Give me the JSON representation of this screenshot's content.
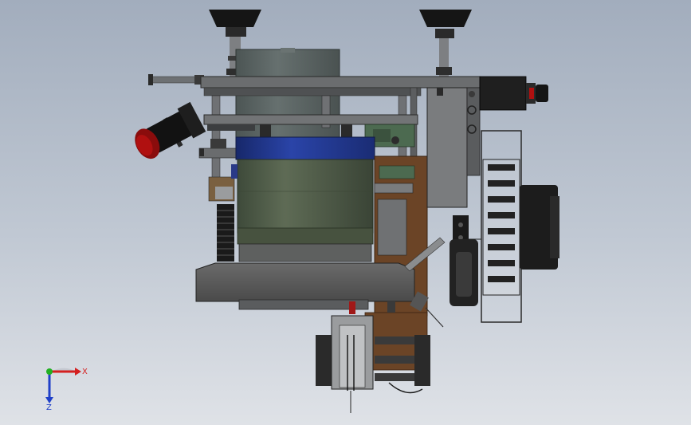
{
  "viewport": {
    "background_top": "#a2adbd",
    "background_bottom": "#dfe2e7"
  },
  "model_colors": {
    "frame": "#4a4c4e",
    "cylinder_blue": "#1f3588",
    "cylinder_green": "#4f5c48",
    "rust_plate": "#6b4426",
    "red_accent": "#b01010"
  },
  "triad": {
    "x_label": "X",
    "z_label": "Z",
    "x_color": "#d42020",
    "y_color": "#22b022",
    "z_color": "#2040c8"
  }
}
